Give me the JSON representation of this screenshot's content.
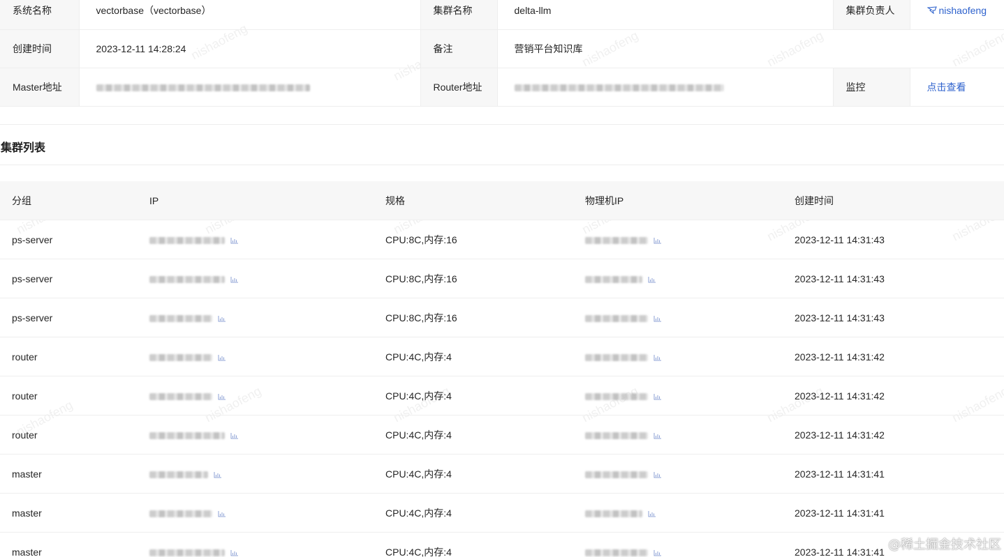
{
  "info": {
    "system_name_label": "系统名称",
    "system_name_value": "vectorbase（vectorbase）",
    "cluster_name_label": "集群名称",
    "cluster_name_value": "delta-llm",
    "owner_label": "集群负责人",
    "owner_value": "nishaofeng",
    "owner_icon": "dingtalk-icon",
    "created_label": "创建时间",
    "created_value": "2023-12-11 14:28:24",
    "remark_label": "备注",
    "remark_value": "营销平台知识库",
    "master_label": "Master地址",
    "router_label": "Router地址",
    "monitor_label": "监控",
    "monitor_link": "点击查看"
  },
  "cluster_list": {
    "title": "集群列表",
    "columns": [
      "分组",
      "IP",
      "规格",
      "物理机IP",
      "创建时间"
    ],
    "rows": [
      {
        "group": "ps-server",
        "spec": "CPU:8C,内存:16",
        "created": "2023-12-11 14:31:43"
      },
      {
        "group": "ps-server",
        "spec": "CPU:8C,内存:16",
        "created": "2023-12-11 14:31:43"
      },
      {
        "group": "ps-server",
        "spec": "CPU:8C,内存:16",
        "created": "2023-12-11 14:31:43"
      },
      {
        "group": "router",
        "spec": "CPU:4C,内存:4",
        "created": "2023-12-11 14:31:42"
      },
      {
        "group": "router",
        "spec": "CPU:4C,内存:4",
        "created": "2023-12-11 14:31:42"
      },
      {
        "group": "router",
        "spec": "CPU:4C,内存:4",
        "created": "2023-12-11 14:31:42"
      },
      {
        "group": "master",
        "spec": "CPU:4C,内存:4",
        "created": "2023-12-11 14:31:41"
      },
      {
        "group": "master",
        "spec": "CPU:4C,内存:4",
        "created": "2023-12-11 14:31:41"
      },
      {
        "group": "master",
        "spec": "CPU:4C,内存:4",
        "created": "2023-12-11 14:31:41"
      }
    ],
    "stat_icon": "bar-chart-icon"
  },
  "watermark": {
    "text": "nishaofeng",
    "corner": "@稀土掘金技术社区"
  },
  "colors": {
    "link": "#2e62cd",
    "label_bg": "#f7f7f7",
    "border": "#eeeeee"
  }
}
